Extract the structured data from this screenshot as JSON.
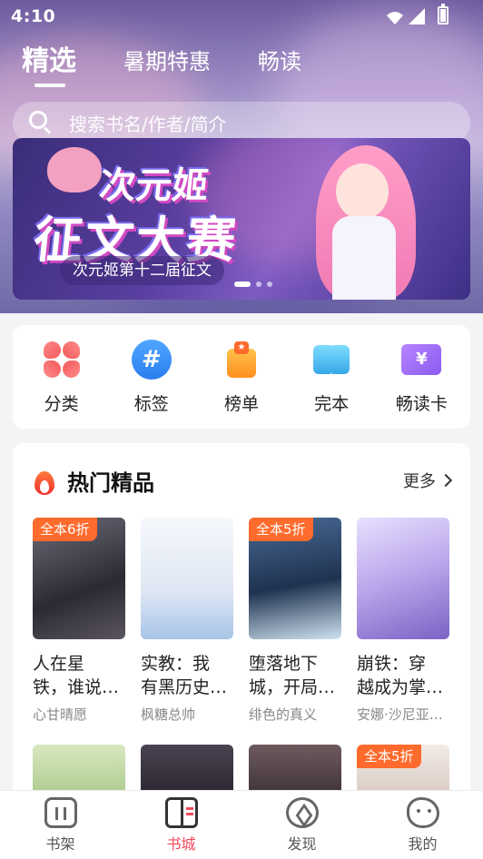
{
  "status_bar": {
    "time": "4:10"
  },
  "top_tabs": [
    {
      "label": "精选",
      "active": true
    },
    {
      "label": "暑期特惠",
      "active": false
    },
    {
      "label": "畅读",
      "active": false
    }
  ],
  "search": {
    "placeholder": "搜索书名/作者/简介"
  },
  "banner": {
    "title_line1": "次元姬",
    "title_line2": "征文大赛",
    "caption": "次元姬第十二届征文"
  },
  "categories": [
    {
      "label": "分类",
      "icon": "clover-icon"
    },
    {
      "label": "标签",
      "icon": "hashtag-icon"
    },
    {
      "label": "榜单",
      "icon": "ranking-icon"
    },
    {
      "label": "完本",
      "icon": "open-book-icon"
    },
    {
      "label": "畅读卡",
      "icon": "yen-card-icon"
    }
  ],
  "hot_section": {
    "title": "热门精品",
    "more_label": "更多",
    "books": [
      {
        "badge": "全本6折",
        "title": "人在星铁，谁说…",
        "title_l1": "人在星",
        "title_l2": "铁，谁说…",
        "author": "心甘晴愿",
        "cover_color": "#4a4a55"
      },
      {
        "badge": "",
        "title": "实教：我有黑历史…",
        "title_l1": "实教：我",
        "title_l2": "有黑历史…",
        "author": "枫糖总帅",
        "cover_color": "#eef2f8"
      },
      {
        "badge": "全本5折",
        "title": "堕落地下城，开局…",
        "title_l1": "堕落地下",
        "title_l2": "城，开局…",
        "author": "绯色的真义",
        "cover_color": "#2f4a6e"
      },
      {
        "badge": "",
        "title": "崩铁：穿越成为掌…",
        "title_l1": "崩铁：穿",
        "title_l2": "越成为掌…",
        "author": "安娜·沙尼亚…",
        "cover_color": "#c9b8ef"
      }
    ],
    "books_row2": [
      {
        "badge": "",
        "cover_color": "#b9d79a"
      },
      {
        "badge": "",
        "cover_color": "#3a3240"
      },
      {
        "badge": "",
        "cover_color": "#5c4a4e"
      },
      {
        "badge": "全本5折",
        "cover_color": "#e8dcd6"
      }
    ]
  },
  "bottom_nav": [
    {
      "label": "书架",
      "active": false
    },
    {
      "label": "书城",
      "active": true
    },
    {
      "label": "发现",
      "active": false
    },
    {
      "label": "我的",
      "active": false
    }
  ],
  "colors": {
    "accent": "#f2485a",
    "badge": "#ff6b2c",
    "hero_purple": "#8e86c0"
  }
}
